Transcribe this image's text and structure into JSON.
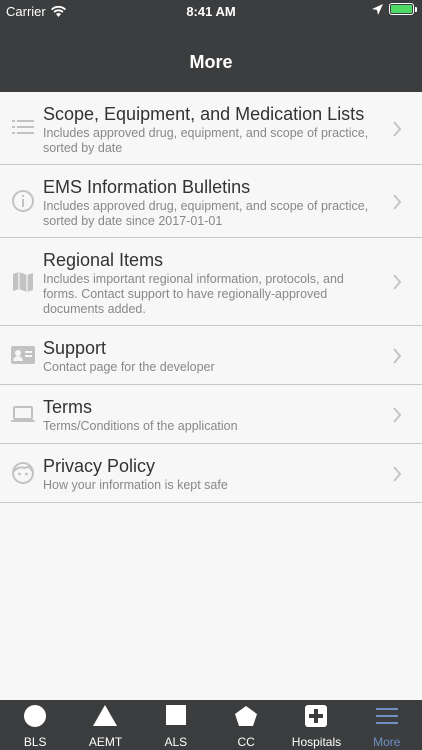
{
  "status": {
    "carrier": "Carrier",
    "time": "8:41 AM"
  },
  "nav": {
    "title": "More"
  },
  "items": [
    {
      "title": "Scope, Equipment, and Medication Lists",
      "description": "Includes approved drug, equipment, and scope of practice, sorted by date",
      "icon": "list-icon"
    },
    {
      "title": "EMS Information Bulletins",
      "description": "Includes approved drug, equipment, and scope of practice, sorted by date since 2017-01-01",
      "icon": "info-icon"
    },
    {
      "title": "Regional Items",
      "description": "Includes important regional information, protocols, and forms. Contact support to have regionally-approved documents added.",
      "icon": "map-icon"
    },
    {
      "title": "Support",
      "description": "Contact page for the developer",
      "icon": "contact-card-icon"
    },
    {
      "title": "Terms",
      "description": "Terms/Conditions of the application",
      "icon": "laptop-icon"
    },
    {
      "title": "Privacy Policy",
      "description": "How your information is kept safe",
      "icon": "face-icon"
    }
  ],
  "tabs": [
    {
      "label": "BLS",
      "icon": "circle-icon",
      "active": false
    },
    {
      "label": "AEMT",
      "icon": "triangle-icon",
      "active": false
    },
    {
      "label": "ALS",
      "icon": "square-icon",
      "active": false
    },
    {
      "label": "CC",
      "icon": "pentagon-icon",
      "active": false
    },
    {
      "label": "Hospitals",
      "icon": "plus-cross-icon",
      "active": false
    },
    {
      "label": "More",
      "icon": "menu-icon",
      "active": true
    }
  ],
  "colors": {
    "header": "#3b3d3e",
    "tab_active": "#6f8fc2",
    "battery": "#4cd964",
    "list_bg": "#f7f7f7"
  }
}
